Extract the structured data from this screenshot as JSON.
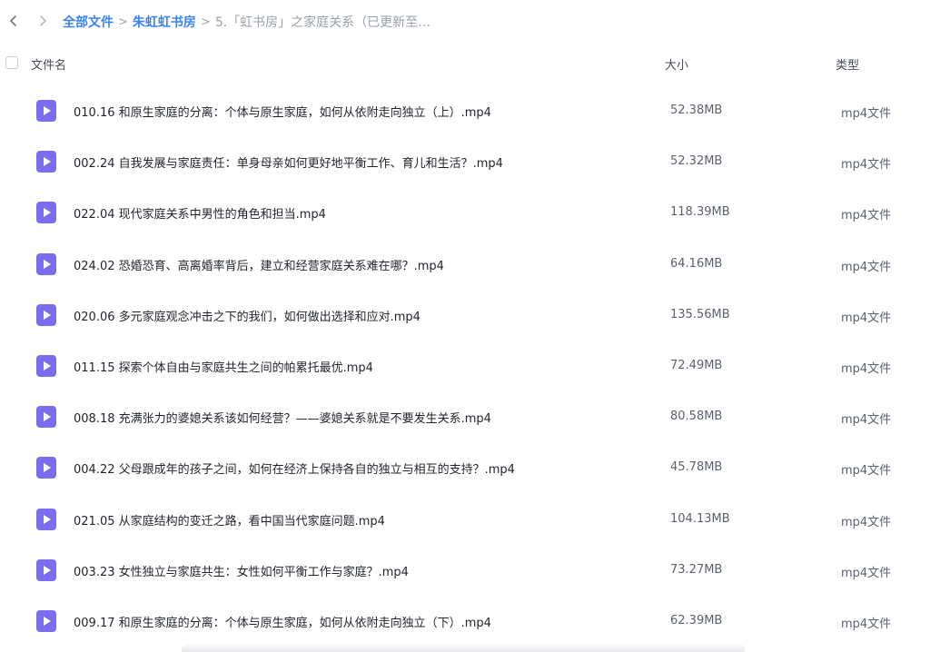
{
  "nav": {
    "back_icon": "chevron-left-icon",
    "forward_icon": "chevron-right-icon"
  },
  "breadcrumb": {
    "items": [
      "全部文件",
      "朱虹虹书房"
    ],
    "separator": ">",
    "current": "5.「虹书房」之家庭关系（已更新至课..."
  },
  "header": {
    "name": "文件名",
    "size": "大小",
    "type": "类型"
  },
  "colors": {
    "accent": "#3b82f6",
    "icon": "#7c6cf0"
  },
  "files": [
    {
      "name": "010.16 和原生家庭的分离：个体与原生家庭，如何从依附走向独立（上）.mp4",
      "size": "52.38MB",
      "type": "mp4文件"
    },
    {
      "name": "002.24 自我发展与家庭责任：单身母亲如何更好地平衡工作、育儿和生活？.mp4",
      "size": "52.32MB",
      "type": "mp4文件"
    },
    {
      "name": "022.04 现代家庭关系中男性的角色和担当.mp4",
      "size": "118.39MB",
      "type": "mp4文件"
    },
    {
      "name": "024.02 恐婚恐育、高离婚率背后，建立和经营家庭关系难在哪？.mp4",
      "size": "64.16MB",
      "type": "mp4文件"
    },
    {
      "name": "020.06 多元家庭观念冲击之下的我们，如何做出选择和应对.mp4",
      "size": "135.56MB",
      "type": "mp4文件"
    },
    {
      "name": "011.15 探索个体自由与家庭共生之间的帕累托最优.mp4",
      "size": "72.49MB",
      "type": "mp4文件"
    },
    {
      "name": "008.18 充满张力的婆媳关系该如何经营？——婆媳关系就是不要发生关系.mp4",
      "size": "80.58MB",
      "type": "mp4文件"
    },
    {
      "name": "004.22 父母跟成年的孩子之间，如何在经济上保持各自的独立与相互的支持？.mp4",
      "size": "45.78MB",
      "type": "mp4文件"
    },
    {
      "name": "021.05 从家庭结构的变迁之路，看中国当代家庭问题.mp4",
      "size": "104.13MB",
      "type": "mp4文件"
    },
    {
      "name": "003.23 女性独立与家庭共生：女性如何平衡工作与家庭？.mp4",
      "size": "73.27MB",
      "type": "mp4文件"
    },
    {
      "name": "009.17 和原生家庭的分离：个体与原生家庭，如何从依附走向独立（下）.mp4",
      "size": "62.39MB",
      "type": "mp4文件"
    }
  ]
}
